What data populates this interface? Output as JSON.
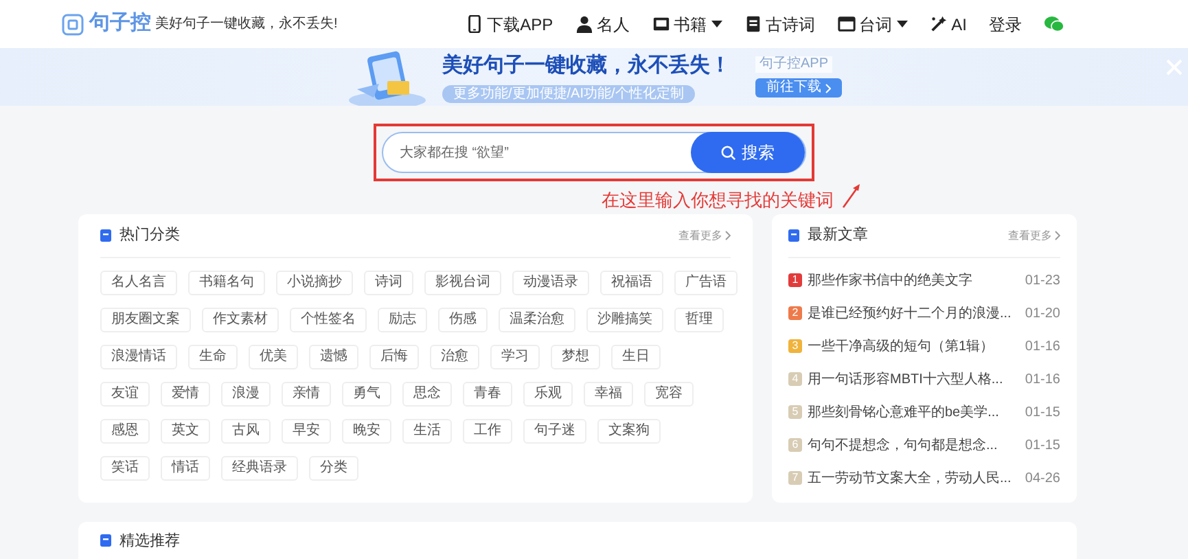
{
  "header": {
    "logo": "句子控",
    "slogan": "美好句子一键收藏，永不丢失!",
    "nav": [
      {
        "kind": "phone",
        "label": "下载APP",
        "dropdown": false
      },
      {
        "kind": "person",
        "label": "名人",
        "dropdown": false
      },
      {
        "kind": "book",
        "label": "书籍",
        "dropdown": true
      },
      {
        "kind": "doc",
        "label": "古诗词",
        "dropdown": false
      },
      {
        "kind": "film",
        "label": "台词",
        "dropdown": true
      },
      {
        "kind": "ai",
        "label": "AI",
        "dropdown": false
      },
      {
        "kind": "text",
        "label": "登录",
        "dropdown": false
      }
    ]
  },
  "banner": {
    "title": "美好句子一键收藏，永不丢失！",
    "subtitle": "更多功能/更加便捷/AI功能/个性化定制",
    "app_label": "句子控APP",
    "button": "前往下载"
  },
  "search": {
    "placeholder": "大家都在搜 “欲望”",
    "button": "搜索"
  },
  "annotation": {
    "text": "在这里输入你想寻找的关键词"
  },
  "categories": {
    "title": "热门分类",
    "more": "查看更多",
    "tag_rows": [
      [
        "名人名言",
        "书籍名句",
        "小说摘抄",
        "诗词",
        "影视台词",
        "动漫语录",
        "祝福语",
        "广告语"
      ],
      [
        "朋友圈文案",
        "作文素材",
        "个性签名",
        "励志",
        "伤感",
        "温柔治愈",
        "沙雕搞笑",
        "哲理"
      ],
      [
        "浪漫情话",
        "生命",
        "优美",
        "遗憾",
        "后悔",
        "治愈",
        "学习",
        "梦想",
        "生日"
      ],
      [
        "友谊",
        "爱情",
        "浪漫",
        "亲情",
        "勇气",
        "思念",
        "青春",
        "乐观",
        "幸福",
        "宽容"
      ],
      [
        "感恩",
        "英文",
        "古风",
        "早安",
        "晚安",
        "生活",
        "工作",
        "句子迷",
        "文案狗"
      ],
      [
        "笑话",
        "情话",
        "经典语录",
        "分类"
      ]
    ]
  },
  "articles": {
    "title": "最新文章",
    "more": "查看更多",
    "items": [
      {
        "rank": "1",
        "color": "#e23b3b",
        "title": "那些作家书信中的绝美文字",
        "date": "01-23"
      },
      {
        "rank": "2",
        "color": "#ee7a4b",
        "title": "是谁已经预约好十二个月的浪漫...",
        "date": "01-20"
      },
      {
        "rank": "3",
        "color": "#f0b33c",
        "title": "一些干净高级的短句（第1辑）",
        "date": "01-16"
      },
      {
        "rank": "4",
        "color": "#d8ccb4",
        "title": "用一句话形容MBTI十六型人格...",
        "date": "01-16"
      },
      {
        "rank": "5",
        "color": "#d8ccb4",
        "title": "那些刻骨铭心意难平的be美学...",
        "date": "01-15"
      },
      {
        "rank": "6",
        "color": "#d8ccb4",
        "title": "句句不提想念，句句都是想念...",
        "date": "01-15"
      },
      {
        "rank": "7",
        "color": "#d8ccb4",
        "title": "五一劳动节文案大全，劳动人民...",
        "date": "04-26"
      }
    ]
  },
  "featured": {
    "title": "精选推荐"
  }
}
